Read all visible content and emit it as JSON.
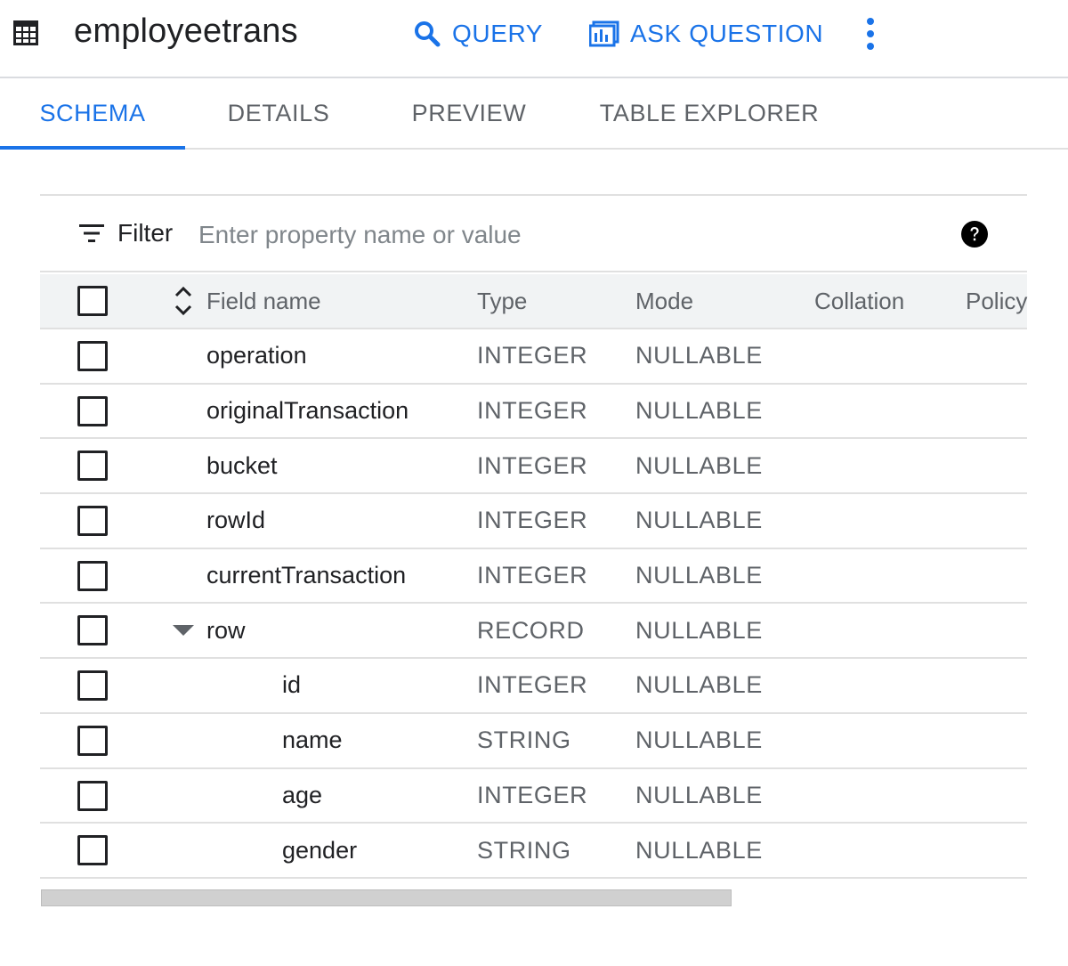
{
  "header": {
    "title": "employeetrans",
    "table_icon": "table-icon",
    "query_label": "QUERY",
    "query_icon": "search-icon",
    "ask_label": "ASK QUESTION",
    "ask_icon": "data-insights-icon",
    "more_icon": "more-vert-icon",
    "accent": "#1a73e8"
  },
  "tabs": [
    {
      "label": "SCHEMA",
      "active": true
    },
    {
      "label": "DETAILS",
      "active": false
    },
    {
      "label": "PREVIEW",
      "active": false
    },
    {
      "label": "TABLE EXPLORER",
      "active": false
    }
  ],
  "filter": {
    "label": "Filter",
    "placeholder": "Enter property name or value",
    "value": "",
    "help_icon": "help-icon"
  },
  "table": {
    "columns": [
      "Field name",
      "Type",
      "Mode",
      "Collation",
      "Policy"
    ],
    "rows": [
      {
        "name": "operation",
        "type": "INTEGER",
        "mode": "NULLABLE",
        "nested": false,
        "expandable": false
      },
      {
        "name": "originalTransaction",
        "type": "INTEGER",
        "mode": "NULLABLE",
        "nested": false,
        "expandable": false
      },
      {
        "name": "bucket",
        "type": "INTEGER",
        "mode": "NULLABLE",
        "nested": false,
        "expandable": false
      },
      {
        "name": "rowId",
        "type": "INTEGER",
        "mode": "NULLABLE",
        "nested": false,
        "expandable": false
      },
      {
        "name": "currentTransaction",
        "type": "INTEGER",
        "mode": "NULLABLE",
        "nested": false,
        "expandable": false
      },
      {
        "name": "row",
        "type": "RECORD",
        "mode": "NULLABLE",
        "nested": false,
        "expandable": true
      },
      {
        "name": "id",
        "type": "INTEGER",
        "mode": "NULLABLE",
        "nested": true,
        "expandable": false
      },
      {
        "name": "name",
        "type": "STRING",
        "mode": "NULLABLE",
        "nested": true,
        "expandable": false
      },
      {
        "name": "age",
        "type": "INTEGER",
        "mode": "NULLABLE",
        "nested": true,
        "expandable": false
      },
      {
        "name": "gender",
        "type": "STRING",
        "mode": "NULLABLE",
        "nested": true,
        "expandable": false
      }
    ]
  }
}
